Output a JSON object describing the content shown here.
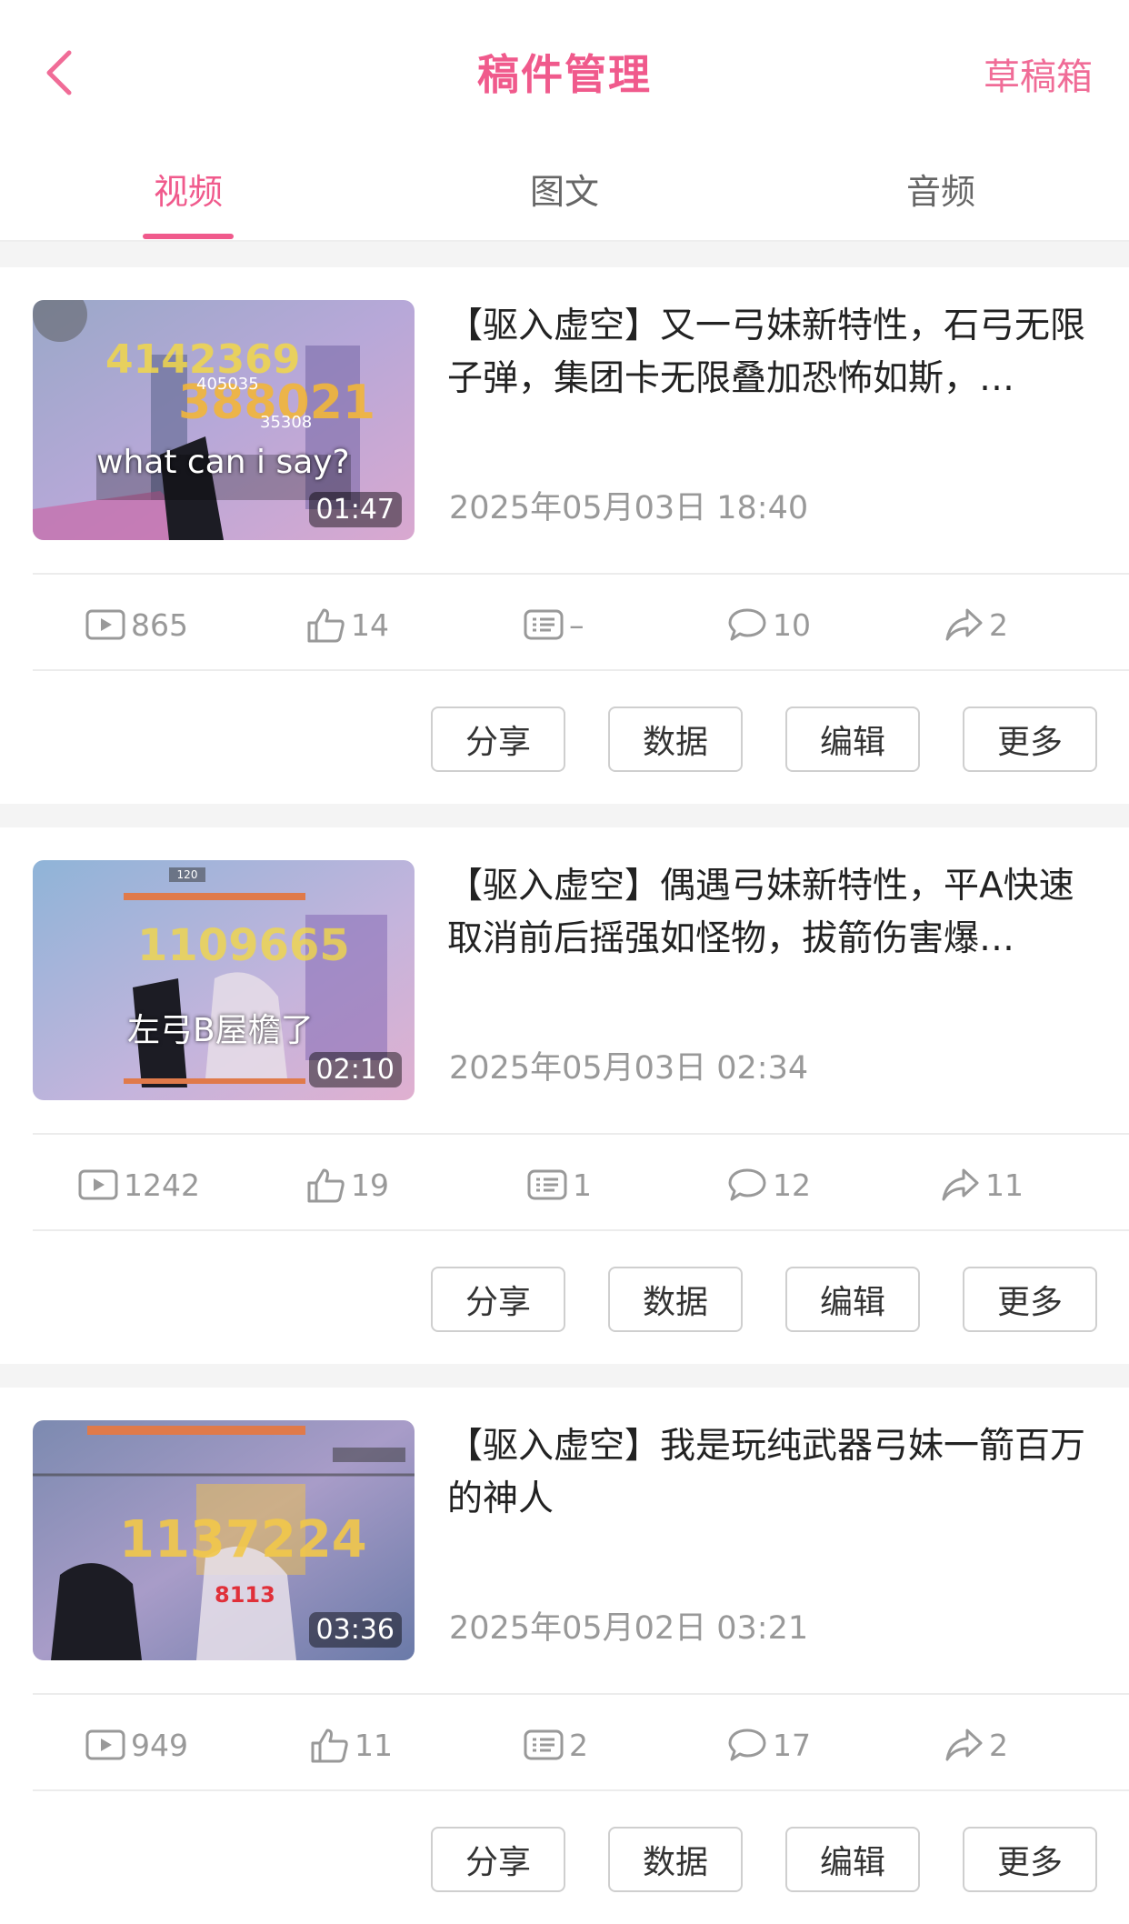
{
  "header": {
    "title": "稿件管理",
    "drafts_label": "草稿箱"
  },
  "tabs": [
    {
      "label": "视频",
      "active": true
    },
    {
      "label": "图文",
      "active": false
    },
    {
      "label": "音频",
      "active": false
    }
  ],
  "accent_color": "#f05a8c",
  "action_labels": {
    "share": "分享",
    "data": "数据",
    "edit": "编辑",
    "more": "更多"
  },
  "posts": [
    {
      "title": "【驱入虚空】又一弓妹新特性，石弓无限子弹，集团卡无限叠加恐怖如斯，…",
      "date": "2025年05月03日 18:40",
      "thumb_caption": "what can i say?",
      "duration": "01:47",
      "thumb_numbers": [
        "4142369",
        "388021",
        "405035",
        "35308"
      ],
      "views": "865",
      "likes": "14",
      "danmaku": "–",
      "comments": "10",
      "shares": "2"
    },
    {
      "title": "【驱入虚空】偶遇弓妹新特性，平A快速取消前后摇强如怪物，拔箭伤害爆…",
      "date": "2025年05月03日 02:34",
      "thumb_caption": "左弓B屋檐了",
      "duration": "02:10",
      "thumb_numbers": [
        "1109665",
        "120"
      ],
      "views": "1242",
      "likes": "19",
      "danmaku": "1",
      "comments": "12",
      "shares": "11"
    },
    {
      "title": "【驱入虚空】我是玩纯武器弓妹一箭百万的神人",
      "date": "2025年05月02日 03:21",
      "thumb_caption": "",
      "duration": "03:36",
      "thumb_numbers": [
        "1137224",
        "8113"
      ],
      "views": "949",
      "likes": "11",
      "danmaku": "2",
      "comments": "17",
      "shares": "2"
    }
  ]
}
